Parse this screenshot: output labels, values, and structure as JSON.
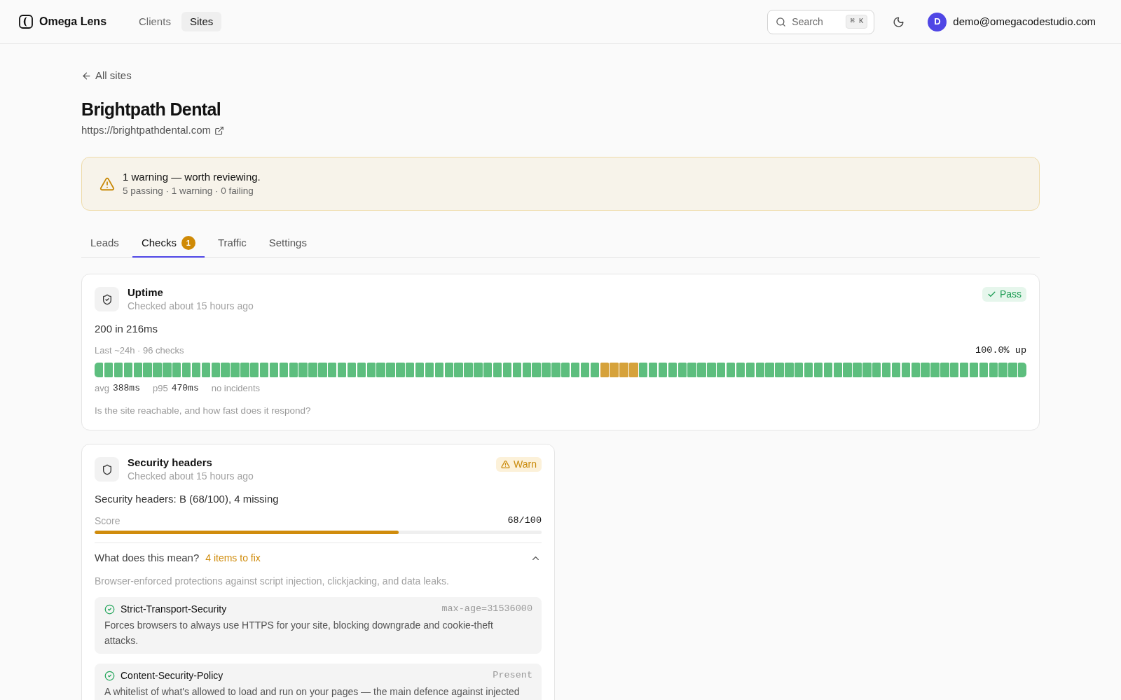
{
  "header": {
    "brand": "Omega Lens",
    "nav": [
      {
        "label": "Clients",
        "selected": false
      },
      {
        "label": "Sites",
        "selected": true
      }
    ],
    "search": {
      "placeholder": "Search",
      "shortcut": "⌘ K"
    },
    "user": {
      "initial": "D",
      "email": "demo@omegacodestudio.com"
    }
  },
  "breadcrumb": {
    "back_link": "All sites"
  },
  "site": {
    "name": "Brightpath Dental",
    "url": "https://brightpathdental.com"
  },
  "alert": {
    "kind": "warning",
    "title": "1 warning — worth reviewing.",
    "summary": "5 passing · 1 warning · 0 failing"
  },
  "tabs": [
    {
      "label": "Leads",
      "selected": false
    },
    {
      "label": "Checks",
      "selected": true,
      "count": "1"
    },
    {
      "label": "Traffic",
      "selected": false
    },
    {
      "label": "Settings",
      "selected": false
    }
  ],
  "checks": [
    {
      "kind": "uptime",
      "title": "Uptime",
      "checked": "Checked about 15 hours ago",
      "badge": {
        "kind": "pass",
        "label": "Pass"
      },
      "summary": "200 in 216ms",
      "history_label": "Last ~24h · 96 checks",
      "uptime": "100.0% up",
      "history": [
        {
          "slow": false
        },
        {
          "slow": false
        },
        {
          "slow": false
        },
        {
          "slow": false
        },
        {
          "slow": false
        },
        {
          "slow": false
        },
        {
          "slow": false
        },
        {
          "slow": false
        },
        {
          "slow": false
        },
        {
          "slow": false
        },
        {
          "slow": false
        },
        {
          "slow": false
        },
        {
          "slow": false
        },
        {
          "slow": false
        },
        {
          "slow": false
        },
        {
          "slow": false
        },
        {
          "slow": false
        },
        {
          "slow": false
        },
        {
          "slow": false
        },
        {
          "slow": false
        },
        {
          "slow": false
        },
        {
          "slow": false
        },
        {
          "slow": false
        },
        {
          "slow": false
        },
        {
          "slow": false
        },
        {
          "slow": false
        },
        {
          "slow": false
        },
        {
          "slow": false
        },
        {
          "slow": false
        },
        {
          "slow": false
        },
        {
          "slow": false
        },
        {
          "slow": false
        },
        {
          "slow": false
        },
        {
          "slow": false
        },
        {
          "slow": false
        },
        {
          "slow": false
        },
        {
          "slow": false
        },
        {
          "slow": false
        },
        {
          "slow": false
        },
        {
          "slow": false
        },
        {
          "slow": false
        },
        {
          "slow": false
        },
        {
          "slow": false
        },
        {
          "slow": false
        },
        {
          "slow": false
        },
        {
          "slow": false
        },
        {
          "slow": false
        },
        {
          "slow": false
        },
        {
          "slow": false
        },
        {
          "slow": false
        },
        {
          "slow": false
        },
        {
          "slow": false
        },
        {
          "slow": true
        },
        {
          "slow": true
        },
        {
          "slow": true
        },
        {
          "slow": true
        },
        {
          "slow": false
        },
        {
          "slow": false
        },
        {
          "slow": false
        },
        {
          "slow": false
        },
        {
          "slow": false
        },
        {
          "slow": false
        },
        {
          "slow": false
        },
        {
          "slow": false
        },
        {
          "slow": false
        },
        {
          "slow": false
        },
        {
          "slow": false
        },
        {
          "slow": false
        },
        {
          "slow": false
        },
        {
          "slow": false
        },
        {
          "slow": false
        },
        {
          "slow": false
        },
        {
          "slow": false
        },
        {
          "slow": false
        },
        {
          "slow": false
        },
        {
          "slow": false
        },
        {
          "slow": false
        },
        {
          "slow": false
        },
        {
          "slow": false
        },
        {
          "slow": false
        },
        {
          "slow": false
        },
        {
          "slow": false
        },
        {
          "slow": false
        },
        {
          "slow": false
        },
        {
          "slow": false
        },
        {
          "slow": false
        },
        {
          "slow": false
        },
        {
          "slow": false
        },
        {
          "slow": false
        },
        {
          "slow": false
        },
        {
          "slow": false
        },
        {
          "slow": false
        },
        {
          "slow": false
        },
        {
          "slow": false
        },
        {
          "slow": false
        },
        {
          "slow": false
        }
      ],
      "stats": [
        {
          "label": "avg",
          "value": "388ms"
        },
        {
          "label": "p95",
          "value": "470ms"
        }
      ],
      "incidents": "no incidents",
      "question": "Is the site reachable, and how fast does it respond?"
    },
    {
      "kind": "score",
      "title": "Security headers",
      "checked": "Checked about 15 hours ago",
      "badge": {
        "kind": "warn",
        "label": "Warn"
      },
      "summary": "Security headers: B (68/100), 4 missing",
      "score": {
        "label": "Score",
        "reading": "68/100",
        "level": 0.68
      },
      "details": {
        "question": "What does this mean?",
        "fix_count": "4 items to fix",
        "expanded": true,
        "description": "Browser-enforced protections against script injection, clickjacking, and data leaks.",
        "items": [
          {
            "name": "Strict-Transport-Security",
            "value": "max-age=31536000",
            "passed": true,
            "description": "Forces browsers to always use HTTPS for your site, blocking downgrade and cookie-theft attacks."
          },
          {
            "name": "Content-Security-Policy",
            "value": "Present",
            "passed": true,
            "description": "A whitelist of what's allowed to load and run on your pages — the main defence against injected"
          }
        ]
      }
    }
  ]
}
